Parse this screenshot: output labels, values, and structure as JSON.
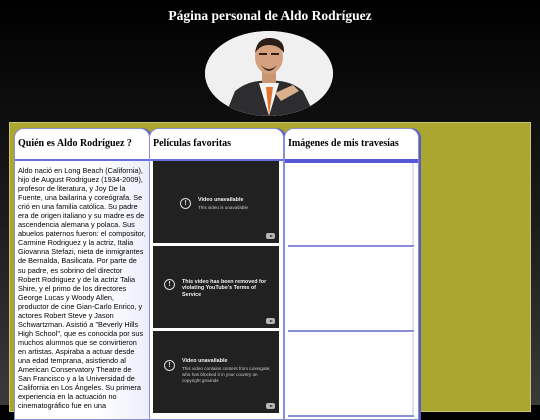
{
  "page": {
    "title": "Página personal de Aldo Rodríguez"
  },
  "columns": {
    "about": {
      "heading": "Quién es Aldo Rodríguez ?",
      "text": "Aldo nació en Long Beach (California), hijo de August Rodriguez (1934-2009), profesor de literatura, y Joy De la Fuente, una bailarina y coreógrafa. Se crió en una familia católica. Su padre era de origen italiano y su madre es de ascendencia alemana y polaca. Sus abuelos paternos fueron: el compositor, Carmine Rodriguez y la actriz, Italia Giovanna Stefazi, nieta de inmigrantes de Bernalda, Basilicata. Por parte de su padre, es sobrino del director Robert Rodriguez y de la actriz Talia Shire, y el primo de los directores George Lucas y Woody Allen, productor de cine Gian-Carlo Enrico, y actores Robert Steve y Jason Schwartzman. Asistió a \"Beverly Hills High School\", que es conocida por sus muchos alumnos que se convirtieron en artistas. Aspiraba a actuar desde una edad temprana, asistiendo al American Conservatory Theatre de San Francisco y a la Universidad de California en Los Ángeles. Su primera experiencia en la actuación no cinematográfico fue en una"
    },
    "movies": {
      "heading": "Películas favoritas",
      "videos": [
        {
          "title": "Video unavailable",
          "message": "This video is unavailable"
        },
        {
          "title": "This video has been removed for violating YouTube's Terms of Service",
          "message": ""
        },
        {
          "title": "Video unavailable",
          "message": "This video contains content from Lionsgate, who has blocked it in your country on copyright grounds"
        }
      ]
    },
    "images": {
      "heading": "Imágenes de mis travesías"
    }
  },
  "colors": {
    "panel_background": "#aaa630",
    "column_border": "#6a6ee0",
    "video_background": "#212121"
  }
}
